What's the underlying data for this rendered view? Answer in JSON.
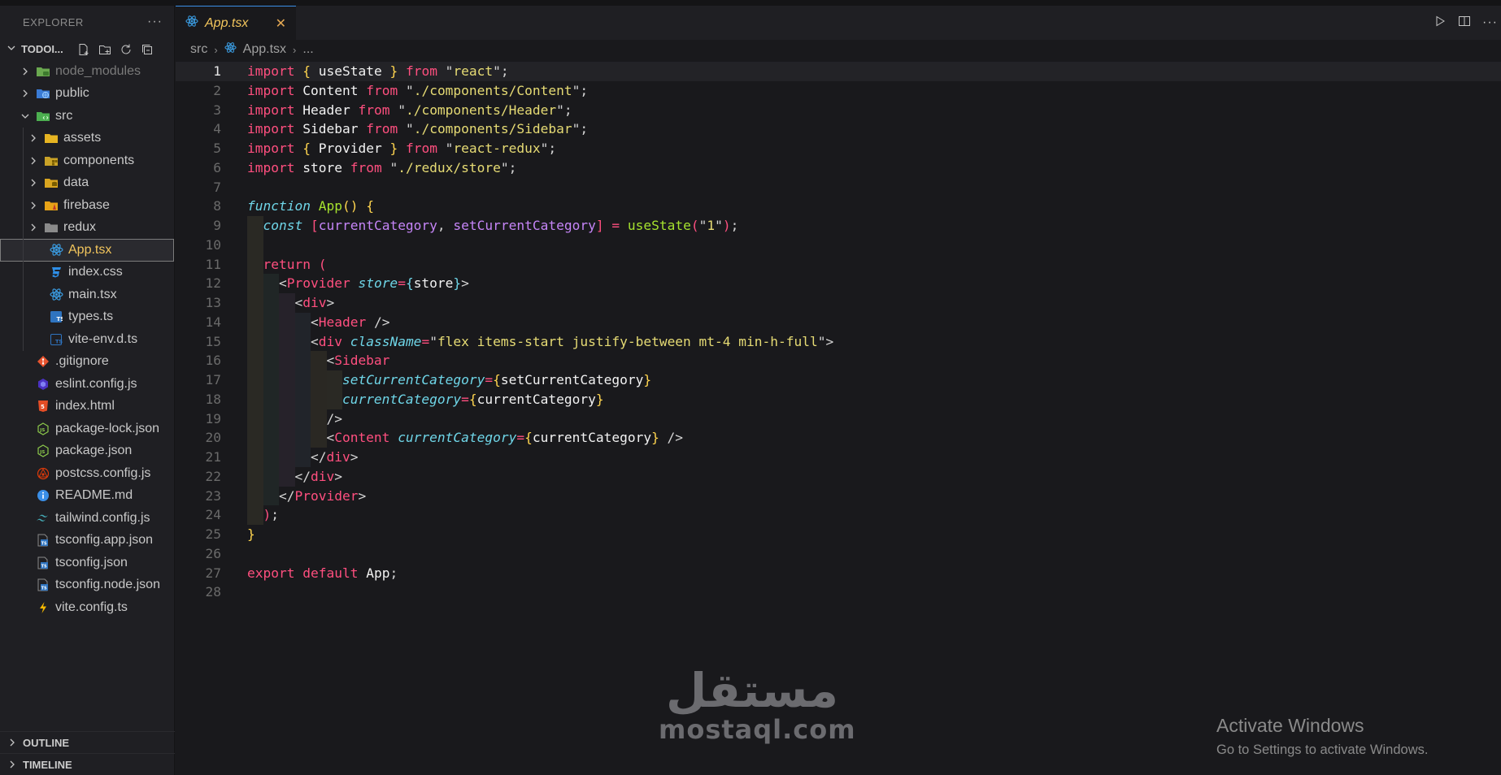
{
  "sidebar": {
    "title": "EXPLORER",
    "more_label": "···",
    "project_name": "TODOI...",
    "items": [
      {
        "label": "node_modules",
        "type": "folder",
        "icon": "folder-green-icon",
        "depth": 0,
        "expanded": false,
        "dim": true
      },
      {
        "label": "public",
        "type": "folder",
        "icon": "globe-folder-icon",
        "depth": 0,
        "expanded": false
      },
      {
        "label": "src",
        "type": "folder",
        "icon": "src-folder-icon",
        "depth": 0,
        "expanded": true
      },
      {
        "label": "assets",
        "type": "folder",
        "icon": "folder-yellow-icon",
        "depth": 1,
        "expanded": false
      },
      {
        "label": "components",
        "type": "folder",
        "icon": "components-folder-icon",
        "depth": 1,
        "expanded": false
      },
      {
        "label": "data",
        "type": "folder",
        "icon": "data-folder-icon",
        "depth": 1,
        "expanded": false
      },
      {
        "label": "firebase",
        "type": "folder",
        "icon": "firebase-folder-icon",
        "depth": 1,
        "expanded": false
      },
      {
        "label": "redux",
        "type": "folder",
        "icon": "folder-gray-icon",
        "depth": 1,
        "expanded": false
      },
      {
        "label": "App.tsx",
        "type": "file",
        "icon": "react-icon",
        "depth": 1,
        "active": true
      },
      {
        "label": "index.css",
        "type": "file",
        "icon": "css-icon",
        "depth": 1
      },
      {
        "label": "main.tsx",
        "type": "file",
        "icon": "react-icon",
        "depth": 1
      },
      {
        "label": "types.ts",
        "type": "file",
        "icon": "typescript-icon",
        "depth": 1
      },
      {
        "label": "vite-env.d.ts",
        "type": "file",
        "icon": "typescript-def-icon",
        "depth": 1
      },
      {
        "label": ".gitignore",
        "type": "file",
        "icon": "git-icon",
        "depth": 0
      },
      {
        "label": "eslint.config.js",
        "type": "file",
        "icon": "eslint-icon",
        "depth": 0
      },
      {
        "label": "index.html",
        "type": "file",
        "icon": "html-icon",
        "depth": 0
      },
      {
        "label": "package-lock.json",
        "type": "file",
        "icon": "nodejs-icon",
        "depth": 0
      },
      {
        "label": "package.json",
        "type": "file",
        "icon": "nodejs-icon",
        "depth": 0
      },
      {
        "label": "postcss.config.js",
        "type": "file",
        "icon": "postcss-icon",
        "depth": 0
      },
      {
        "label": "README.md",
        "type": "file",
        "icon": "info-icon",
        "depth": 0
      },
      {
        "label": "tailwind.config.js",
        "type": "file",
        "icon": "tailwind-icon",
        "depth": 0
      },
      {
        "label": "tsconfig.app.json",
        "type": "file",
        "icon": "tsconfig-icon",
        "depth": 0
      },
      {
        "label": "tsconfig.json",
        "type": "file",
        "icon": "tsconfig-icon",
        "depth": 0
      },
      {
        "label": "tsconfig.node.json",
        "type": "file",
        "icon": "tsconfig-icon",
        "depth": 0
      },
      {
        "label": "vite.config.ts",
        "type": "file",
        "icon": "vite-icon",
        "depth": 0
      }
    ],
    "sections": [
      {
        "label": "OUTLINE"
      },
      {
        "label": "TIMELINE"
      }
    ]
  },
  "editor": {
    "tab_label": "App.tsx",
    "tab_close": "✕",
    "breadcrumb": [
      "src",
      "App.tsx",
      "..."
    ],
    "current_line": 1,
    "lines": [
      {
        "n": "1",
        "tokens": [
          [
            "k",
            "import"
          ],
          [
            "pn",
            " "
          ],
          [
            "br1",
            "{"
          ],
          [
            "pn",
            " "
          ],
          [
            "id",
            "useState"
          ],
          [
            "pn",
            " "
          ],
          [
            "br1",
            "}"
          ],
          [
            "pn",
            " "
          ],
          [
            "k",
            "from"
          ],
          [
            "pn",
            " \""
          ],
          [
            "s",
            "react"
          ],
          [
            "pn",
            "\";"
          ]
        ]
      },
      {
        "n": "2",
        "tokens": [
          [
            "k",
            "import"
          ],
          [
            "pn",
            " "
          ],
          [
            "id",
            "Content"
          ],
          [
            "pn",
            " "
          ],
          [
            "k",
            "from"
          ],
          [
            "pn",
            " \""
          ],
          [
            "s",
            "./components/Content"
          ],
          [
            "pn",
            "\";"
          ]
        ]
      },
      {
        "n": "3",
        "tokens": [
          [
            "k",
            "import"
          ],
          [
            "pn",
            " "
          ],
          [
            "id",
            "Header"
          ],
          [
            "pn",
            " "
          ],
          [
            "k",
            "from"
          ],
          [
            "pn",
            " \""
          ],
          [
            "s",
            "./components/Header"
          ],
          [
            "pn",
            "\";"
          ]
        ]
      },
      {
        "n": "4",
        "tokens": [
          [
            "k",
            "import"
          ],
          [
            "pn",
            " "
          ],
          [
            "id",
            "Sidebar"
          ],
          [
            "pn",
            " "
          ],
          [
            "k",
            "from"
          ],
          [
            "pn",
            " \""
          ],
          [
            "s",
            "./components/Sidebar"
          ],
          [
            "pn",
            "\";"
          ]
        ]
      },
      {
        "n": "5",
        "tokens": [
          [
            "k",
            "import"
          ],
          [
            "pn",
            " "
          ],
          [
            "br1",
            "{"
          ],
          [
            "pn",
            " "
          ],
          [
            "id",
            "Provider"
          ],
          [
            "pn",
            " "
          ],
          [
            "br1",
            "}"
          ],
          [
            "pn",
            " "
          ],
          [
            "k",
            "from"
          ],
          [
            "pn",
            " \""
          ],
          [
            "s",
            "react-redux"
          ],
          [
            "pn",
            "\";"
          ]
        ]
      },
      {
        "n": "6",
        "tokens": [
          [
            "k",
            "import"
          ],
          [
            "pn",
            " "
          ],
          [
            "id",
            "store"
          ],
          [
            "pn",
            " "
          ],
          [
            "k",
            "from"
          ],
          [
            "pn",
            " \""
          ],
          [
            "s",
            "./redux/store"
          ],
          [
            "pn",
            "\";"
          ]
        ]
      },
      {
        "n": "7",
        "tokens": []
      },
      {
        "n": "8",
        "tokens": [
          [
            "kf",
            "function"
          ],
          [
            "pn",
            " "
          ],
          [
            "fn",
            "App"
          ],
          [
            "br1",
            "()"
          ],
          [
            "pn",
            " "
          ],
          [
            "br1",
            "{"
          ]
        ]
      },
      {
        "n": "9",
        "tokens": [
          [
            "pn",
            "  "
          ],
          [
            "kf",
            "const"
          ],
          [
            "pn",
            " "
          ],
          [
            "br2",
            "["
          ],
          [
            "vr",
            "currentCategory"
          ],
          [
            "pn",
            ", "
          ],
          [
            "vr",
            "setCurrentCategory"
          ],
          [
            "br2",
            "]"
          ],
          [
            "pn",
            " "
          ],
          [
            "k",
            "="
          ],
          [
            "pn",
            " "
          ],
          [
            "fn",
            "useState"
          ],
          [
            "br2",
            "("
          ],
          [
            "pn",
            "\""
          ],
          [
            "s",
            "1"
          ],
          [
            "pn",
            "\""
          ],
          [
            "br2",
            ")"
          ],
          [
            "pn",
            ";"
          ]
        ]
      },
      {
        "n": "10",
        "tokens": []
      },
      {
        "n": "11",
        "tokens": [
          [
            "pn",
            "  "
          ],
          [
            "k",
            "return"
          ],
          [
            "pn",
            " "
          ],
          [
            "br2",
            "("
          ]
        ]
      },
      {
        "n": "12",
        "tokens": [
          [
            "pn",
            "    <"
          ],
          [
            "tg",
            "Provider"
          ],
          [
            "pn",
            " "
          ],
          [
            "at",
            "store"
          ],
          [
            "k",
            "="
          ],
          [
            "br3",
            "{"
          ],
          [
            "id",
            "store"
          ],
          [
            "br3",
            "}"
          ],
          [
            "pn",
            ">"
          ]
        ]
      },
      {
        "n": "13",
        "tokens": [
          [
            "pn",
            "      <"
          ],
          [
            "tg",
            "div"
          ],
          [
            "pn",
            ">"
          ]
        ]
      },
      {
        "n": "14",
        "tokens": [
          [
            "pn",
            "        <"
          ],
          [
            "tg",
            "Header"
          ],
          [
            "pn",
            " />"
          ]
        ]
      },
      {
        "n": "15",
        "tokens": [
          [
            "pn",
            "        <"
          ],
          [
            "tg",
            "div"
          ],
          [
            "pn",
            " "
          ],
          [
            "at",
            "className"
          ],
          [
            "k",
            "="
          ],
          [
            "pn",
            "\""
          ],
          [
            "s",
            "flex items-start justify-between mt-4 min-h-full"
          ],
          [
            "pn",
            "\">"
          ]
        ]
      },
      {
        "n": "16",
        "tokens": [
          [
            "pn",
            "          <"
          ],
          [
            "tg",
            "Sidebar"
          ]
        ]
      },
      {
        "n": "17",
        "tokens": [
          [
            "pn",
            "            "
          ],
          [
            "at",
            "setCurrentCategory"
          ],
          [
            "k",
            "="
          ],
          [
            "br1",
            "{"
          ],
          [
            "id",
            "setCurrentCategory"
          ],
          [
            "br1",
            "}"
          ]
        ]
      },
      {
        "n": "18",
        "tokens": [
          [
            "pn",
            "            "
          ],
          [
            "at",
            "currentCategory"
          ],
          [
            "k",
            "="
          ],
          [
            "br1",
            "{"
          ],
          [
            "id",
            "currentCategory"
          ],
          [
            "br1",
            "}"
          ]
        ]
      },
      {
        "n": "19",
        "tokens": [
          [
            "pn",
            "          />"
          ]
        ]
      },
      {
        "n": "20",
        "tokens": [
          [
            "pn",
            "          <"
          ],
          [
            "tg",
            "Content"
          ],
          [
            "pn",
            " "
          ],
          [
            "at",
            "currentCategory"
          ],
          [
            "k",
            "="
          ],
          [
            "br1",
            "{"
          ],
          [
            "id",
            "currentCategory"
          ],
          [
            "br1",
            "}"
          ],
          [
            "pn",
            " />"
          ]
        ]
      },
      {
        "n": "21",
        "tokens": [
          [
            "pn",
            "        </"
          ],
          [
            "tg",
            "div"
          ],
          [
            "pn",
            ">"
          ]
        ]
      },
      {
        "n": "22",
        "tokens": [
          [
            "pn",
            "      </"
          ],
          [
            "tg",
            "div"
          ],
          [
            "pn",
            ">"
          ]
        ]
      },
      {
        "n": "23",
        "tokens": [
          [
            "pn",
            "    </"
          ],
          [
            "tg",
            "Provider"
          ],
          [
            "pn",
            ">"
          ]
        ]
      },
      {
        "n": "24",
        "tokens": [
          [
            "pn",
            "  "
          ],
          [
            "br2",
            ")"
          ],
          [
            "pn",
            ";"
          ]
        ]
      },
      {
        "n": "25",
        "tokens": [
          [
            "br1",
            "}"
          ]
        ]
      },
      {
        "n": "26",
        "tokens": []
      },
      {
        "n": "27",
        "tokens": [
          [
            "k",
            "export"
          ],
          [
            "pn",
            " "
          ],
          [
            "k",
            "default"
          ],
          [
            "pn",
            " "
          ],
          [
            "id",
            "App"
          ],
          [
            "pn",
            ";"
          ]
        ]
      },
      {
        "n": "28",
        "tokens": []
      }
    ]
  },
  "watermark": {
    "arabic": "مستقل",
    "latin": "mostaql.com"
  },
  "activation": {
    "title": "Activate Windows",
    "subtitle": "Go to Settings to activate Windows."
  }
}
